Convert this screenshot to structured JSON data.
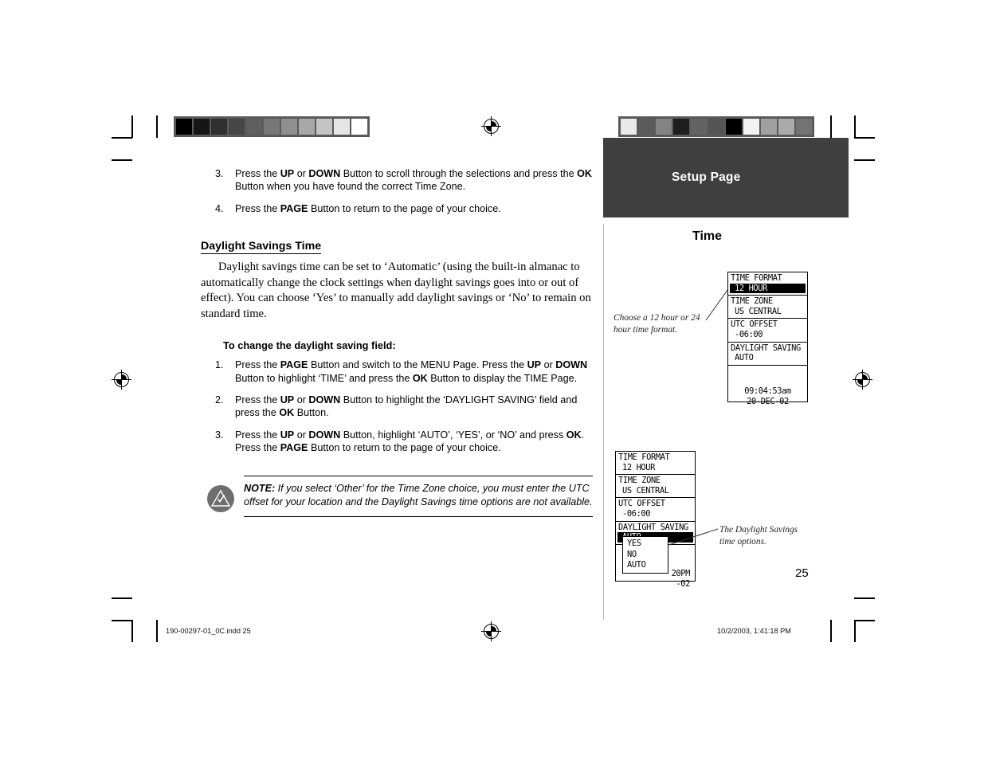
{
  "document": {
    "page_number": "25",
    "sidebar_banner": "Setup Page",
    "section_title": "Time"
  },
  "top_steps": [
    {
      "num": "3.",
      "parts": [
        {
          "t": "Press the ",
          "b": false
        },
        {
          "t": "UP",
          "b": true
        },
        {
          "t": " or ",
          "b": false
        },
        {
          "t": "DOWN",
          "b": true
        },
        {
          "t": " Button to scroll through the selections and press the ",
          "b": false
        },
        {
          "t": "OK",
          "b": true
        },
        {
          "t": " Button when you have found the correct Time Zone.",
          "b": false
        }
      ]
    },
    {
      "num": "4.",
      "parts": [
        {
          "t": "Press the ",
          "b": false
        },
        {
          "t": "PAGE",
          "b": true
        },
        {
          "t": " Button to return to the page of your choice.",
          "b": false
        }
      ]
    }
  ],
  "section": {
    "heading": "Daylight Savings Time",
    "paragraph": "Daylight savings time can be set to ‘Automatic’ (using the built-in almanac to automatically change the clock settings when daylight savings goes into or out of effect). You can choose ‘Yes’ to manually add daylight savings or ‘No’ to remain on standard time.",
    "subheading": "To change the daylight saving field:"
  },
  "procedure_steps": [
    {
      "num": "1.",
      "parts": [
        {
          "t": "Press the ",
          "b": false
        },
        {
          "t": "PAGE",
          "b": true
        },
        {
          "t": " Button and switch to the MENU Page. Press the ",
          "b": false
        },
        {
          "t": "UP",
          "b": true
        },
        {
          "t": " or ",
          "b": false
        },
        {
          "t": "DOWN",
          "b": true
        },
        {
          "t": " Button to highlight ‘TIME’ and press the ",
          "b": false
        },
        {
          "t": "OK",
          "b": true
        },
        {
          "t": " Button to display the TIME Page.",
          "b": false
        }
      ]
    },
    {
      "num": "2.",
      "parts": [
        {
          "t": "Press the ",
          "b": false
        },
        {
          "t": "UP",
          "b": true
        },
        {
          "t": " or ",
          "b": false
        },
        {
          "t": "DOWN",
          "b": true
        },
        {
          "t": " Button to highlight the ‘DAYLIGHT SAVING’ field and press the ",
          "b": false
        },
        {
          "t": "OK",
          "b": true
        },
        {
          "t": " Button.",
          "b": false
        }
      ]
    },
    {
      "num": "3.",
      "parts": [
        {
          "t": "Press the ",
          "b": false
        },
        {
          "t": "UP",
          "b": true
        },
        {
          "t": " or ",
          "b": false
        },
        {
          "t": "DOWN",
          "b": true
        },
        {
          "t": " Button, highlight ‘AUTO’, ‘YES’, or ‘NO’ and press ",
          "b": false
        },
        {
          "t": "OK",
          "b": true
        },
        {
          "t": ". Press the ",
          "b": false
        },
        {
          "t": "PAGE",
          "b": true
        },
        {
          "t": " Button to return to the page of your choice.",
          "b": false
        }
      ]
    }
  ],
  "note": {
    "label": "NOTE:",
    "text": " If you select ‘Other’ for the Time Zone choice, you must enter the UTC offset for your location and the Daylight Savings time options are not available.",
    "icon": "note-check-triangle-icon"
  },
  "screen_one": {
    "rows": [
      {
        "label": "TIME FORMAT",
        "value": "12 HOUR",
        "highlighted": true
      },
      {
        "label": "TIME ZONE",
        "value": "US CENTRAL",
        "highlighted": false
      },
      {
        "label": "UTC OFFSET",
        "value": "-06:00",
        "highlighted": false
      },
      {
        "label": "DAYLIGHT SAVING",
        "value": "AUTO",
        "highlighted": false
      }
    ],
    "clock_time": "09:04:53am",
    "clock_date": "20-DEC-02"
  },
  "screen_two": {
    "rows": [
      {
        "label": "TIME FORMAT",
        "value": "12 HOUR",
        "highlighted": false
      },
      {
        "label": "TIME ZONE",
        "value": "US CENTRAL",
        "highlighted": false
      },
      {
        "label": "UTC OFFSET",
        "value": "-06:00",
        "highlighted": false
      },
      {
        "label": "DAYLIGHT SAVING",
        "value": "AUTO",
        "highlighted": true
      }
    ],
    "clock_time_partial": "20PM",
    "clock_date_partial": "-02",
    "dropdown": {
      "options": [
        "YES",
        "NO",
        "AUTO"
      ],
      "selected": "AUTO"
    }
  },
  "captions": {
    "screen_one": "Choose a 12 hour or 24 hour time format.",
    "screen_two": "The Daylight Savings time options."
  },
  "footer": {
    "file": "190-00297-01_0C.indd   25",
    "timestamp": "10/2/2003, 1:41:18 PM"
  },
  "color_bars": {
    "left": [
      "#000000",
      "#161616",
      "#2f2f2f",
      "#474747",
      "#5f5f5f",
      "#787878",
      "#8f8f8f",
      "#a8a8a8",
      "#c4c4c4",
      "#e6e6e6",
      "#ffffff"
    ],
    "right": [
      "#e9e9e9",
      "#5b5b5b",
      "#848484",
      "#1e1e1e",
      "#636363",
      "#555555",
      "#000000",
      "#f2f2f2",
      "#a0a0a0",
      "#aaaaaa",
      "#737373"
    ]
  },
  "theme": {
    "banner_bg": "#3f3f3f",
    "divider": "#b9b9b9",
    "note_icon_bg": "#6e6e6e"
  }
}
